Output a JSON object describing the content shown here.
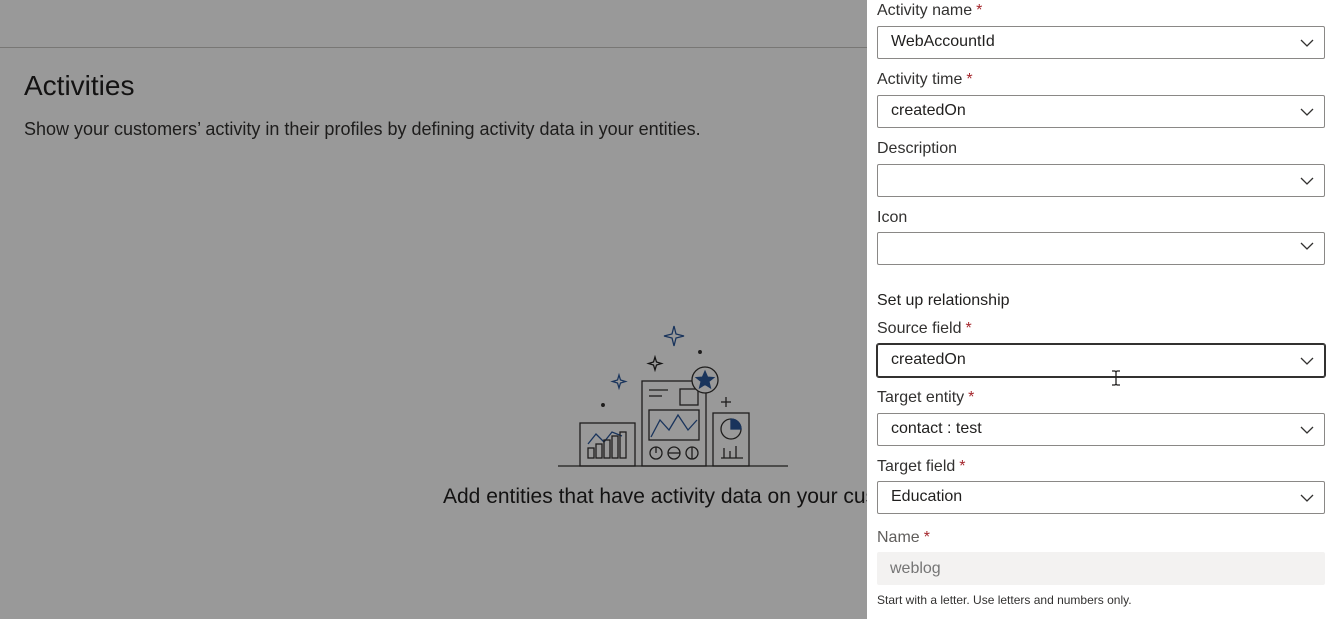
{
  "page": {
    "title": "Activities",
    "subtitle": "Show your customers’ activity in their profiles by defining activity data in your entities.",
    "empty_message": "Add entities that have activity data on your custor",
    "illustration_icon": "activities-illustration-icon"
  },
  "panel": {
    "activity_name": {
      "label": "Activity name",
      "required": "*",
      "value": "WebAccountId"
    },
    "activity_time": {
      "label": "Activity time",
      "required": "*",
      "value": "createdOn"
    },
    "description": {
      "label": "Description",
      "value": ""
    },
    "icon": {
      "label": "Icon",
      "value": ""
    },
    "relationship_heading": "Set up relationship",
    "source_field": {
      "label": "Source field",
      "required": "*",
      "value": "createdOn"
    },
    "target_entity": {
      "label": "Target entity",
      "required": "*",
      "value": "contact : test"
    },
    "target_field": {
      "label": "Target field",
      "required": "*",
      "value": "Education"
    },
    "name": {
      "label": "Name",
      "required": "*",
      "placeholder": "weblog"
    },
    "helper_text": "Start with a letter. Use letters and numbers only."
  },
  "colors": {
    "accent": "#2b579a",
    "required": "#a4262c",
    "overlay": "rgba(0,0,0,0.4)"
  }
}
